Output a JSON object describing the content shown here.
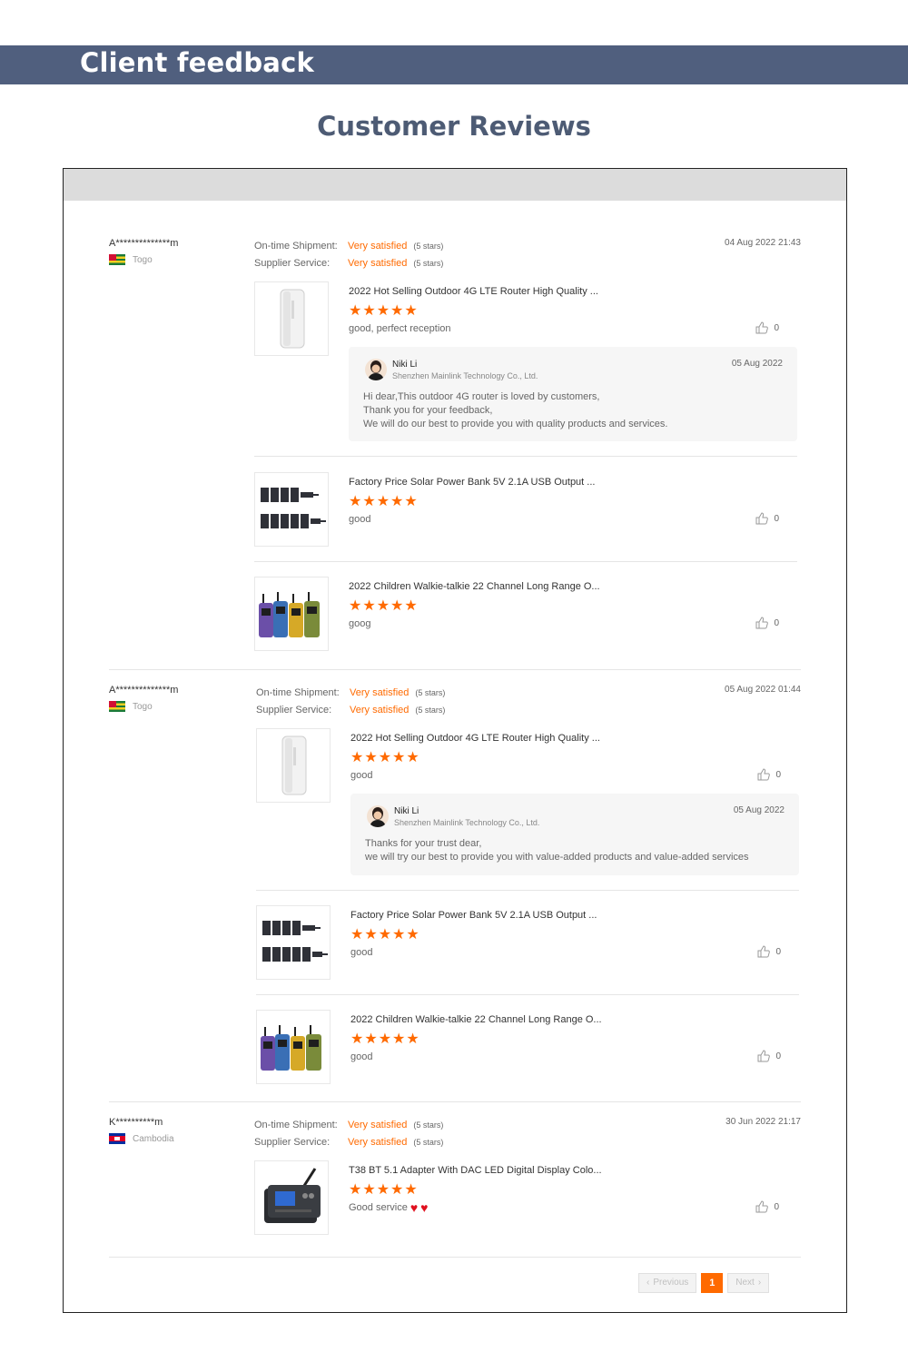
{
  "banner": {
    "title": "Client feedback"
  },
  "page_title": "Customer Reviews",
  "labels": {
    "ontime": "On-time Shipment:",
    "supplier": "Supplier Service:",
    "satisfied": "Very satisfied",
    "five_stars": "(5 stars)",
    "stars_glyph": "★★★★★",
    "like_count": "0"
  },
  "reviews": [
    {
      "buyer": "A**************m",
      "country": "Togo",
      "date": "04 Aug 2022 21:43",
      "items": [
        {
          "title": "2022 Hot Selling Outdoor 4G LTE Router High Quality ...",
          "rating": 5,
          "comment": "good, perfect reception",
          "likes": "0",
          "image": "router-image",
          "reply": {
            "name": "Niki Li",
            "company": "Shenzhen Mainlink Technology Co., Ltd.",
            "date": "05 Aug 2022",
            "lines": [
              "Hi dear,This outdoor 4G router is loved by customers,",
              "Thank you for your feedback,",
              "We will do our best to provide you with quality products and services."
            ]
          }
        },
        {
          "title": "Factory Price Solar Power Bank 5V 2.1A USB Output ...",
          "rating": 5,
          "comment": "good",
          "likes": "0",
          "image": "solar-panel-image"
        },
        {
          "title": "2022 Children Walkie-talkie 22 Channel Long Range O...",
          "rating": 5,
          "comment": "goog",
          "likes": "0",
          "image": "walkie-talkie-image"
        }
      ]
    },
    {
      "buyer": "A**************m",
      "country": "Togo",
      "date": "05 Aug 2022 01:44",
      "items": [
        {
          "title": "2022 Hot Selling Outdoor 4G LTE Router High Quality ...",
          "rating": 5,
          "comment": "good",
          "likes": "0",
          "image": "router-image",
          "reply": {
            "name": "Niki Li",
            "company": "Shenzhen Mainlink Technology Co., Ltd.",
            "date": "05 Aug 2022",
            "lines": [
              "Thanks for your trust dear,",
              "we will try our best to provide you with value-added products and value-added services"
            ]
          }
        },
        {
          "title": "Factory Price Solar Power Bank 5V 2.1A USB Output ...",
          "rating": 5,
          "comment": "good",
          "likes": "0",
          "image": "solar-panel-image"
        },
        {
          "title": "2022 Children Walkie-talkie 22 Channel Long Range O...",
          "rating": 5,
          "comment": "good",
          "likes": "0",
          "image": "walkie-talkie-image"
        }
      ]
    },
    {
      "buyer": "K**********m",
      "country": "Cambodia",
      "date": "30 Jun 2022 21:17",
      "items": [
        {
          "title": "T38 BT 5.1 Adapter With DAC LED Digital Display Colo...",
          "rating": 5,
          "comment": "Good service",
          "likes": "0",
          "image": "bluetooth-adapter-image",
          "comment_icons": [
            "heart-icon",
            "heart-icon"
          ]
        }
      ]
    }
  ],
  "pagination": {
    "previous": "Previous",
    "current": "1",
    "next": "Next"
  },
  "colors": {
    "banner": "#505f7e",
    "accent": "#ff6a00",
    "title": "#4d5b74"
  }
}
